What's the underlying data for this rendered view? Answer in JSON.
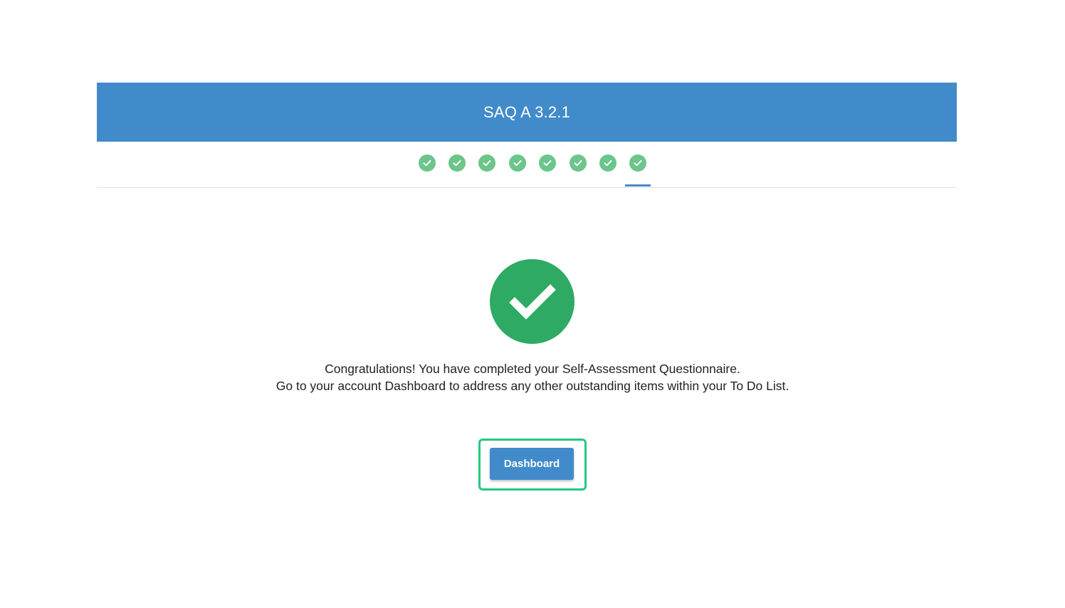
{
  "header": {
    "title": "SAQ A 3.2.1",
    "color": "#428bca"
  },
  "progress": {
    "total_steps": 8,
    "completed_steps": 8,
    "current_step": 8,
    "step_icon": "check-icon",
    "complete_color": "#6cc58b"
  },
  "result": {
    "icon": "check-circle-icon",
    "icon_color": "#2eaa64",
    "line1": "Congratulations! You have completed your Self-Assessment Questionnaire.",
    "line2": "Go to your account Dashboard to address any other outstanding items within your To Do List."
  },
  "actions": {
    "dashboard_label": "Dashboard",
    "highlight_color": "#22c97f"
  }
}
